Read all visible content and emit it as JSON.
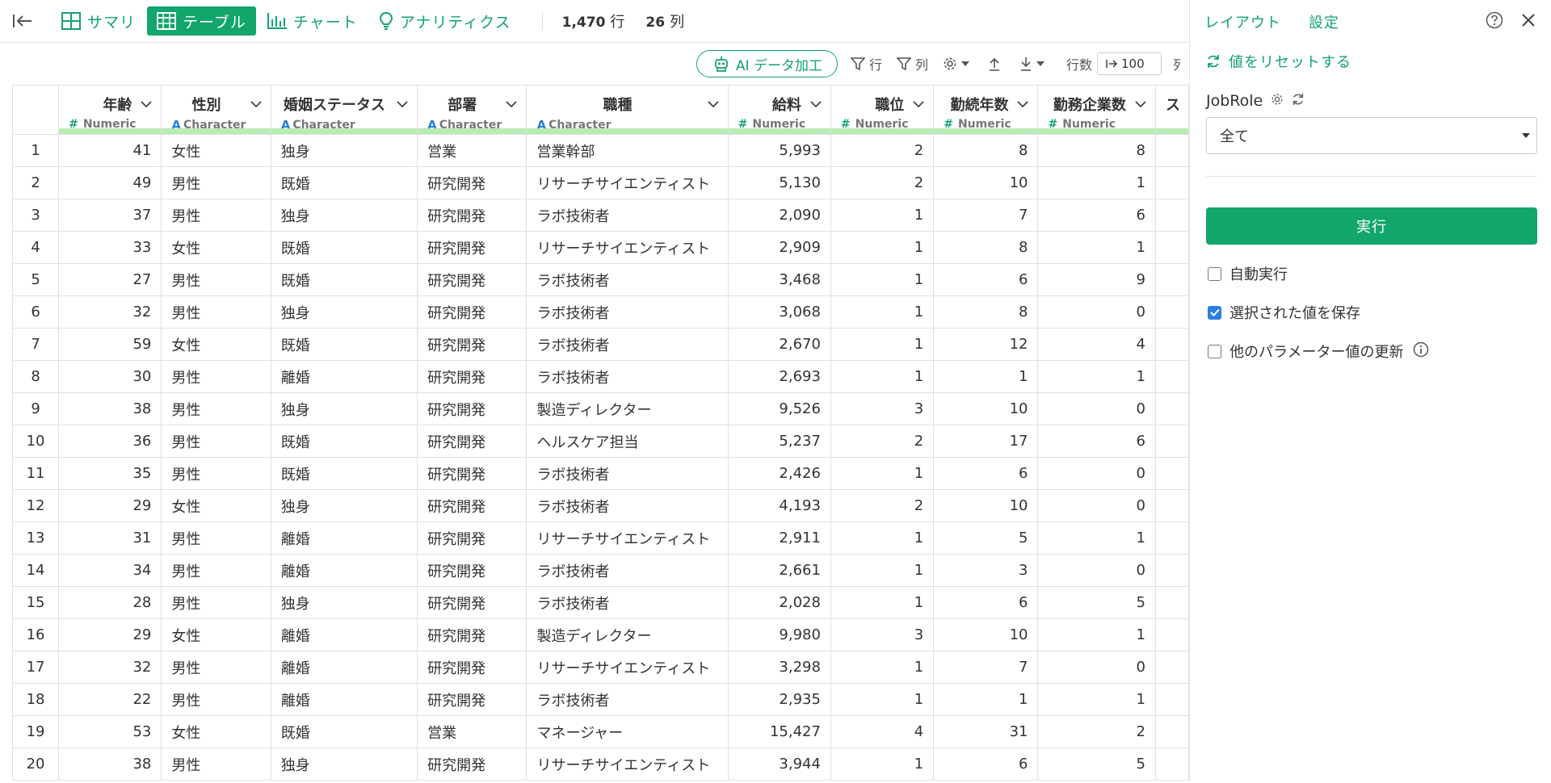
{
  "toolbar": {
    "tabs": [
      {
        "label": "サマリ",
        "icon": "summary-grid-icon"
      },
      {
        "label": "テーブル",
        "icon": "table-icon"
      },
      {
        "label": "チャート",
        "icon": "bar-chart-icon"
      },
      {
        "label": "アナリティクス",
        "icon": "lightbulb-icon"
      }
    ],
    "row_count": "1,470",
    "row_unit": "行",
    "col_count": "26",
    "col_unit": "列"
  },
  "toolbar2": {
    "ai_label": "AI データ加工",
    "row_filter_label": "行",
    "col_filter_label": "列",
    "rows_label": "行数",
    "rows_value": "100",
    "cut_text": "列"
  },
  "table": {
    "columns": [
      {
        "name": "年齢",
        "type": "Numeric",
        "kind": "num"
      },
      {
        "name": "性別",
        "type": "Character",
        "kind": "chr"
      },
      {
        "name": "婚姻ステータス",
        "type": "Character",
        "kind": "chr"
      },
      {
        "name": "部署",
        "type": "Character",
        "kind": "chr"
      },
      {
        "name": "職種",
        "type": "Character",
        "kind": "chr"
      },
      {
        "name": "給料",
        "type": "Numeric",
        "kind": "num"
      },
      {
        "name": "職位",
        "type": "Numeric",
        "kind": "num"
      },
      {
        "name": "勤続年数",
        "type": "Numeric",
        "kind": "num"
      },
      {
        "name": "勤務企業数",
        "type": "Numeric",
        "kind": "num"
      },
      {
        "name": "ス",
        "type": "",
        "kind": "chr"
      }
    ],
    "rows": [
      [
        "41",
        "女性",
        "独身",
        "営業",
        "営業幹部",
        "5,993",
        "2",
        "8",
        "8"
      ],
      [
        "49",
        "男性",
        "既婚",
        "研究開発",
        "リサーチサイエンティスト",
        "5,130",
        "2",
        "10",
        "1"
      ],
      [
        "37",
        "男性",
        "独身",
        "研究開発",
        "ラボ技術者",
        "2,090",
        "1",
        "7",
        "6"
      ],
      [
        "33",
        "女性",
        "既婚",
        "研究開発",
        "リサーチサイエンティスト",
        "2,909",
        "1",
        "8",
        "1"
      ],
      [
        "27",
        "男性",
        "既婚",
        "研究開発",
        "ラボ技術者",
        "3,468",
        "1",
        "6",
        "9"
      ],
      [
        "32",
        "男性",
        "独身",
        "研究開発",
        "ラボ技術者",
        "3,068",
        "1",
        "8",
        "0"
      ],
      [
        "59",
        "女性",
        "既婚",
        "研究開発",
        "ラボ技術者",
        "2,670",
        "1",
        "12",
        "4"
      ],
      [
        "30",
        "男性",
        "離婚",
        "研究開発",
        "ラボ技術者",
        "2,693",
        "1",
        "1",
        "1"
      ],
      [
        "38",
        "男性",
        "独身",
        "研究開発",
        "製造ディレクター",
        "9,526",
        "3",
        "10",
        "0"
      ],
      [
        "36",
        "男性",
        "既婚",
        "研究開発",
        "ヘルスケア担当",
        "5,237",
        "2",
        "17",
        "6"
      ],
      [
        "35",
        "男性",
        "既婚",
        "研究開発",
        "ラボ技術者",
        "2,426",
        "1",
        "6",
        "0"
      ],
      [
        "29",
        "女性",
        "独身",
        "研究開発",
        "ラボ技術者",
        "4,193",
        "2",
        "10",
        "0"
      ],
      [
        "31",
        "男性",
        "離婚",
        "研究開発",
        "リサーチサイエンティスト",
        "2,911",
        "1",
        "5",
        "1"
      ],
      [
        "34",
        "男性",
        "離婚",
        "研究開発",
        "ラボ技術者",
        "2,661",
        "1",
        "3",
        "0"
      ],
      [
        "28",
        "男性",
        "独身",
        "研究開発",
        "ラボ技術者",
        "2,028",
        "1",
        "6",
        "5"
      ],
      [
        "29",
        "女性",
        "離婚",
        "研究開発",
        "製造ディレクター",
        "9,980",
        "3",
        "10",
        "1"
      ],
      [
        "32",
        "男性",
        "離婚",
        "研究開発",
        "リサーチサイエンティスト",
        "3,298",
        "1",
        "7",
        "0"
      ],
      [
        "22",
        "男性",
        "離婚",
        "研究開発",
        "ラボ技術者",
        "2,935",
        "1",
        "1",
        "1"
      ],
      [
        "53",
        "女性",
        "既婚",
        "営業",
        "マネージャー",
        "15,427",
        "4",
        "31",
        "2"
      ],
      [
        "38",
        "男性",
        "独身",
        "研究開発",
        "リサーチサイエンティスト",
        "3,944",
        "1",
        "6",
        "5"
      ]
    ]
  },
  "panel": {
    "tabs": [
      "レイアウト",
      "設定"
    ],
    "reset_label": "値をリセットする",
    "param_name": "JobRole",
    "select_value": "全て",
    "run_label": "実行",
    "checkboxes": [
      {
        "label": "自動実行",
        "checked": false
      },
      {
        "label": "選択された値を保存",
        "checked": true
      },
      {
        "label": "他のパラメーター値の更新",
        "checked": false
      }
    ]
  },
  "colors": {
    "accent": "#12a56c",
    "header_bar": "#b8ecb4",
    "checkbox_on": "#2a7fe0"
  }
}
